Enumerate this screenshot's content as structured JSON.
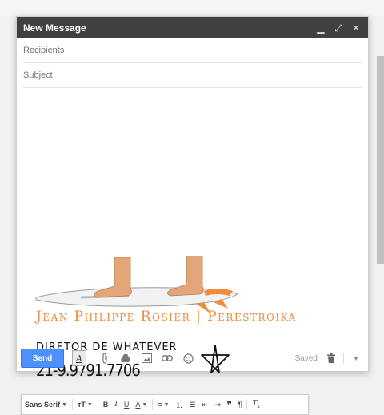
{
  "window": {
    "title": "New Message"
  },
  "fields": {
    "recipients_placeholder": "Recipients",
    "subject_placeholder": "Subject"
  },
  "signature": {
    "name_line": "Jean Philippe Rosier | Perestroika",
    "role": "Diretor de Whatever",
    "phone": "21-9.9791.7706"
  },
  "format_toolbar": {
    "font_family": "Sans Serif",
    "bold": "B",
    "italic": "I",
    "underline": "U",
    "text_color": "A"
  },
  "bottom_bar": {
    "send_label": "Send",
    "saved_status": "Saved"
  },
  "colors": {
    "accent_orange": "#f08a3c",
    "send_blue": "#4d90fe",
    "titlebar": "#404040"
  }
}
